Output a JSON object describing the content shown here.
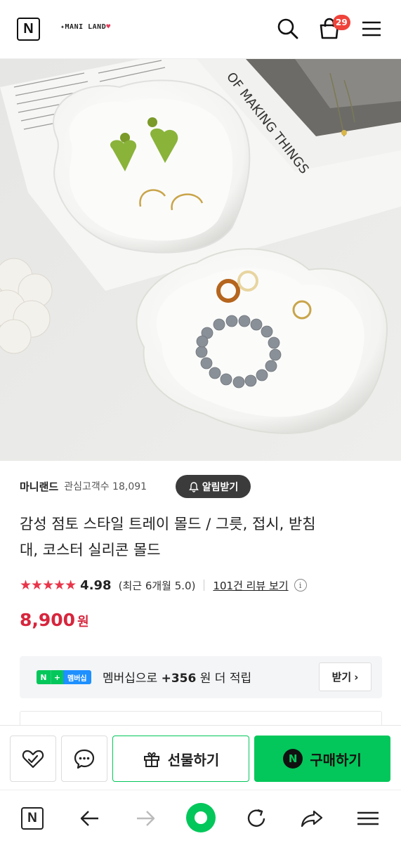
{
  "header": {
    "logo_letter": "N",
    "brand_logo": "MANI LAND",
    "cart_count": "29"
  },
  "product": {
    "image_alt": "product-photo"
  },
  "seller": {
    "name": "마니랜드",
    "followers": "관심고객수 18,091",
    "alarm_button": "알림받기"
  },
  "title_line1": "감성 점토 스타일 트레이 몰드 / 그릇, 접시, 받침",
  "title_line2": "대, 코스터 실리콘 몰드",
  "rating": {
    "stars": "★★★★★",
    "score": "4.98",
    "recent": "(최근 6개월 5.0)",
    "review_link": "101건 리뷰 보기",
    "info": "i"
  },
  "price": {
    "amount": "8,900",
    "unit": "원"
  },
  "membership": {
    "badge_n": "N",
    "badge_plus": "+",
    "badge_label": "멤버십",
    "text_prefix": "멤버십으로 ",
    "text_amount": "+356",
    "text_suffix": " 원 더 적립",
    "receive_button": "받기",
    "receive_arrow": "›"
  },
  "actions": {
    "gift_label": "선물하기",
    "buy_label": "구매하기",
    "buy_icon": "N"
  },
  "browser": {
    "home_letter": "N"
  },
  "colors": {
    "naver_green": "#03c75a",
    "price_red": "#d7263d",
    "star_red": "#e8354a",
    "badge_red": "#f0433a"
  }
}
